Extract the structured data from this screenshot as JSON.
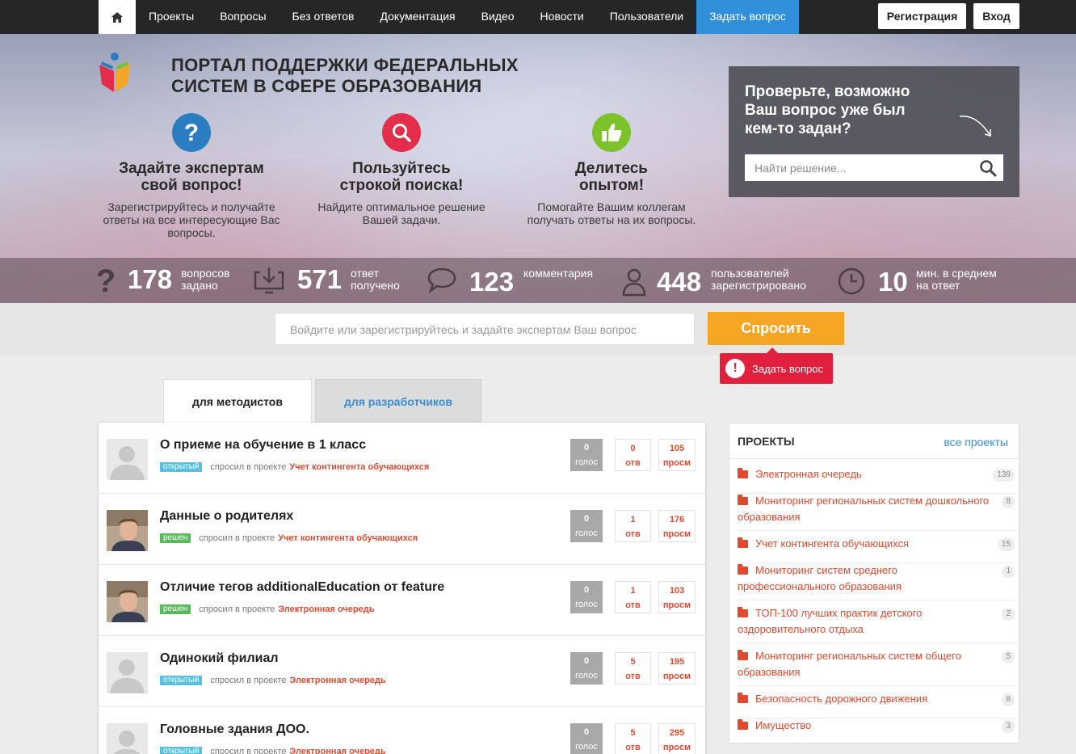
{
  "nav": {
    "home_icon": "home-icon",
    "items": [
      {
        "label": "Проекты"
      },
      {
        "label": "Вопросы"
      },
      {
        "label": "Без ответов"
      },
      {
        "label": "Документация"
      },
      {
        "label": "Видео"
      },
      {
        "label": "Новости"
      },
      {
        "label": "Пользователи"
      },
      {
        "label": "Задать вопрос"
      }
    ],
    "register_label": "Регистрация",
    "login_label": "Вход"
  },
  "hero": {
    "title_line1": "ПОРТАЛ ПОДДЕРЖКИ ФЕДЕРАЛЬНЫХ",
    "title_line2": "СИСТЕМ В СФЕРЕ ОБРАЗОВАНИЯ",
    "features": [
      {
        "icon": "question-icon",
        "color": "#2a7dc0",
        "title_line1": "Задайте экспертам",
        "title_line2": "свой вопрос!",
        "text": "Зарегистрируйтесь и получайте ответы на все интересующие Вас вопросы."
      },
      {
        "icon": "search-icon",
        "color": "#e22e4a",
        "title_line1": "Пользуйтесь",
        "title_line2": "строкой поиска!",
        "text": "Найдите оптимальное решение Вашей задачи."
      },
      {
        "icon": "thumbs-up-icon",
        "color": "#7cc22a",
        "title_line1": "Делитесь",
        "title_line2": "опытом!",
        "text": "Помогайте Вашим коллегам получать ответы на их вопросы."
      }
    ],
    "search_box": {
      "title": "Проверьте, возможно Ваш вопрос уже был кем-то задан?",
      "placeholder": "Найти решение..."
    },
    "stats": [
      {
        "icon": "question-mark-icon",
        "number": "178",
        "label_line1": "вопросов",
        "label_line2": "задано"
      },
      {
        "icon": "download-icon",
        "number": "571",
        "label_line1": "ответ",
        "label_line2": "получено"
      },
      {
        "icon": "comment-icon",
        "number": "123",
        "label_line1": "комментария",
        "label_line2": ""
      },
      {
        "icon": "user-icon",
        "number": "448",
        "label_line1": "пользователей",
        "label_line2": "зарегистрировано"
      },
      {
        "icon": "clock-icon",
        "number": "10",
        "label_line1": "мин. в среднем",
        "label_line2": "на ответ"
      }
    ]
  },
  "ask": {
    "placeholder": "Войдите или зарегистрируйтесь и задайте экспертам Ваш вопрос",
    "button": "Спросить",
    "tooltip": "Задать вопрос",
    "tooltip_icon": "!"
  },
  "tabs": [
    {
      "label": "для методистов"
    },
    {
      "label": "для разработчиков"
    }
  ],
  "questions": [
    {
      "title": "О приеме на обучение в 1 класс",
      "status": "открытый",
      "status_type": "open",
      "asked": "спросил в проекте",
      "project": "Учет контингента обучающихся",
      "votes": "0",
      "votes_label": "голос",
      "answers": "0",
      "answers_label": "отв",
      "views": "105",
      "views_label": "просм",
      "avatar": "placeholder"
    },
    {
      "title": "Данные о родителях",
      "status": "решен",
      "status_type": "solved",
      "asked": "спросил в проекте",
      "project": "Учет контингента обучающихся",
      "votes": "0",
      "votes_label": "голос",
      "answers": "1",
      "answers_label": "отв",
      "views": "176",
      "views_label": "просм",
      "avatar": "photo"
    },
    {
      "title": "Отличие тегов additionalEducation от feature",
      "status": "решен",
      "status_type": "solved",
      "asked": "спросил в проекте",
      "project": "Электронная очередь",
      "votes": "0",
      "votes_label": "голос",
      "answers": "1",
      "answers_label": "отв",
      "views": "103",
      "views_label": "просм",
      "avatar": "photo"
    },
    {
      "title": "Одинокий филиал",
      "status": "открытый",
      "status_type": "open",
      "asked": "спросил в проекте",
      "project": "Электронная очередь",
      "votes": "0",
      "votes_label": "голос",
      "answers": "5",
      "answers_label": "отв",
      "views": "195",
      "views_label": "просм",
      "avatar": "placeholder"
    },
    {
      "title": "Головные здания ДОО.",
      "status": "открытый",
      "status_type": "open",
      "asked": "спросил в проекте",
      "project": "Электронная очередь",
      "votes": "0",
      "votes_label": "голос",
      "answers": "5",
      "answers_label": "отв",
      "views": "295",
      "views_label": "просм",
      "avatar": "placeholder"
    }
  ],
  "projects": {
    "header": "ПРОЕКТЫ",
    "all_link": "все проекты",
    "items": [
      {
        "name": "Электронная очередь",
        "count": "139"
      },
      {
        "name": "Мониторинг региональных систем дошкольного образования",
        "count": "8"
      },
      {
        "name": "Учет контингента обучающихся",
        "count": "15"
      },
      {
        "name": "Мониторинг систем среднего профессионального образования",
        "count": "1"
      },
      {
        "name": "ТОП-100 лучших практик детского оздоровительного отдыха",
        "count": "2"
      },
      {
        "name": "Мониторинг региональных систем общего образования",
        "count": "5"
      },
      {
        "name": "Безопасность дорожного движения",
        "count": "8"
      },
      {
        "name": "Имущество",
        "count": "3"
      }
    ]
  },
  "colors": {
    "nav_bg": "#262626",
    "accent_blue": "#2f8fd8",
    "ask_button": "#f5a623",
    "link_red": "#e04a2f",
    "tooltip_red": "#e0203c"
  }
}
